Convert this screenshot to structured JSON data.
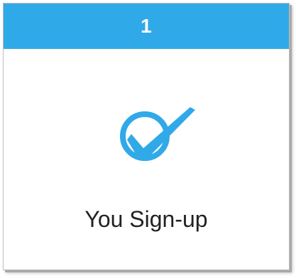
{
  "step": {
    "number": "1",
    "label": "You Sign-up",
    "icon": "check-circle-icon",
    "accent_color": "#30a9e8"
  }
}
